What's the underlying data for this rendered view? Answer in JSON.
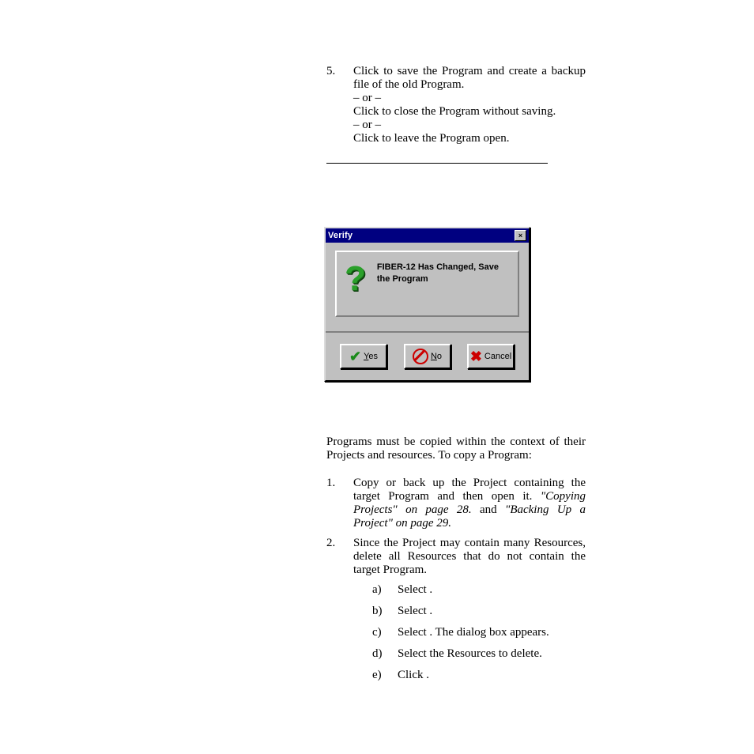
{
  "step5": {
    "num": "5.",
    "line1_a": "Click ",
    "line1_b": " to save the Program and create a backup file of the old Program.",
    "or": "– or –",
    "line2_a": "Click ",
    "line2_b": " to close the Program without saving.",
    "line3_a": "Click ",
    "line3_b": " to leave the Program open."
  },
  "dialog": {
    "title": "Verify",
    "message": "FIBER-12 Has Changed, Save the Program",
    "yes": "Yes",
    "no": "No",
    "cancel": "Cancel"
  },
  "copy": {
    "intro": "Programs must be copied within the context of their Projects and resources. To copy a Program:",
    "s1": {
      "n": "1.",
      "a": "Copy or back up the Project containing the target Program and then open it. ",
      "ref1": "\"Copying Projects\" on page 28.",
      "mid": " and ",
      "ref2": "\"Backing Up a Project\" on page 29."
    },
    "s2": {
      "n": "2.",
      "t": "Since the Project may contain many Resources, delete all Resources that do not contain the target Program."
    },
    "sa": {
      "n": "a)",
      "t1": "Select ",
      "t2": "."
    },
    "sb": {
      "n": "b)",
      "t1": "Select ",
      "t2": "."
    },
    "sc": {
      "n": "c)",
      "t1": "Select ",
      "t2": ".  The ",
      "t3": " dialog box appears."
    },
    "sd": {
      "n": "d)",
      "t": "Select the Resources to delete."
    },
    "se": {
      "n": "e)",
      "t1": "Click ",
      "t2": "."
    }
  }
}
